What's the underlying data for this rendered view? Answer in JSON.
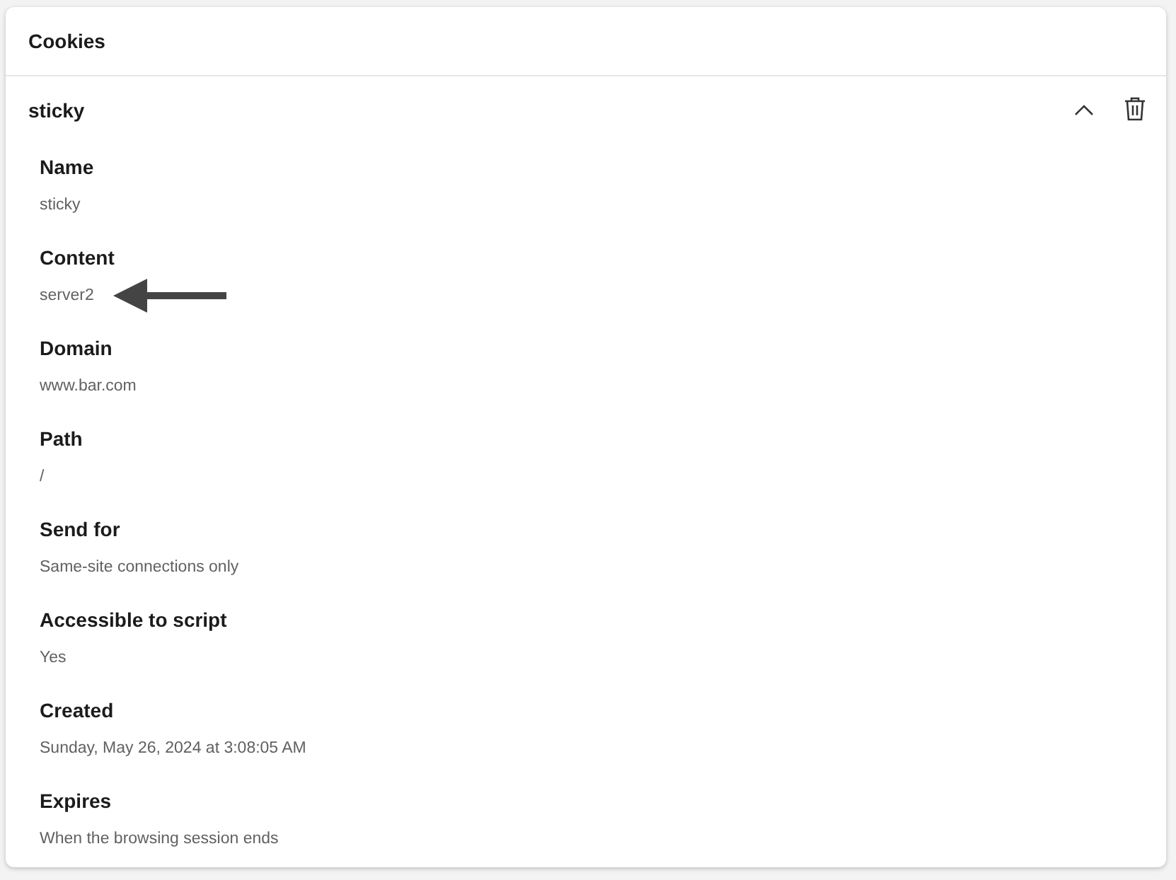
{
  "panel": {
    "title": "Cookies"
  },
  "cookie": {
    "name": "sticky",
    "expanded": true,
    "fields": [
      {
        "label": "Name",
        "value": "sticky",
        "pointer": false
      },
      {
        "label": "Content",
        "value": "server2",
        "pointer": true
      },
      {
        "label": "Domain",
        "value": "www.bar.com",
        "pointer": false
      },
      {
        "label": "Path",
        "value": "/",
        "pointer": false
      },
      {
        "label": "Send for",
        "value": "Same-site connections only",
        "pointer": false
      },
      {
        "label": "Accessible to script",
        "value": "Yes",
        "pointer": false
      },
      {
        "label": "Created",
        "value": "Sunday, May 26, 2024 at 3:08:05 AM",
        "pointer": false
      },
      {
        "label": "Expires",
        "value": "When the browsing session ends",
        "pointer": false
      }
    ]
  }
}
